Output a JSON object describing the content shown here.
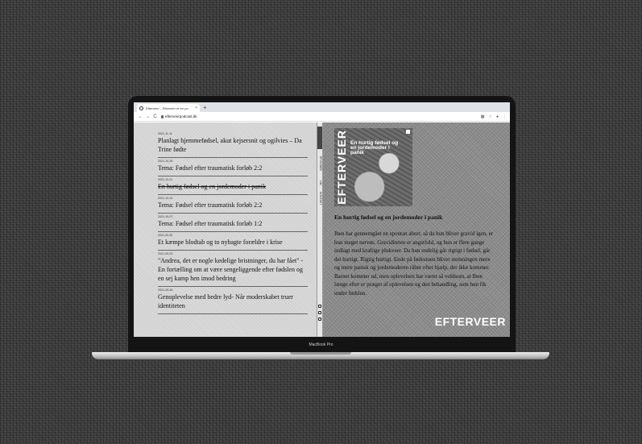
{
  "browser": {
    "tab_title": "Efterveer – Efterveer er en pu",
    "tab_close": "×",
    "new_tab": "+",
    "nav_back": "←",
    "nav_forward": "→",
    "nav_reload": "C",
    "url": "efterveerpodcast.dk",
    "toolbar_icons": [
      "extensions-icon",
      "star-icon",
      "profile-icon",
      "menu-icon"
    ]
  },
  "episodes": [
    {
      "date": "2021-11-11",
      "title": "Planlagt hjemmefødsel, akut kejsersnit og ogilvies – Da Trine fødte",
      "struck": false
    },
    {
      "date": "2021-10-28",
      "title": "Tema: Fødsel efter traumatisk forløb 2:2",
      "struck": false
    },
    {
      "date": "2021-10-21",
      "title": "En hurtig fødsel og en jordemoder i panik",
      "struck": true
    },
    {
      "date": "2021-10-14",
      "title": "Tema: Fødsel efter traumatisk forløb 2:2",
      "struck": false
    },
    {
      "date": "2021-10-07",
      "title": "Tema: Fødsel efter traumatisk forløb 1:2",
      "struck": false
    },
    {
      "date": "2021-09-30",
      "title": "Et kæmpe blodtab og to nybagte forældre i krise",
      "struck": false
    },
    {
      "date": "2021-09-23",
      "title": "\"Andrea, det er nogle kedelige bristninger, du har fået\" - En fortælling om at være sengeliggende efter fødslen og en sej kamp hen imod bedring",
      "struck": false
    },
    {
      "date": "2021-09-16",
      "title": "Genoplevelse med bedre lyd- Når moderskabet truer identiteten",
      "struck": false
    }
  ],
  "side_nav": {
    "labels": [
      "EPISODER",
      "OM",
      "KONTAKT"
    ],
    "social_icons": [
      "instagram-icon",
      "facebook-icon",
      "mail-icon"
    ]
  },
  "detail": {
    "cover_brand": "EFTERVEER",
    "cover_text": "En hurtig fødsel og en jordemoder i panik",
    "heading": "En hurtig fødsel og en jordemoder i panik",
    "description": "Iben har gennemgået en spontan abort, så da hun bliver gravid igen, er hun meget nervøs. Graviditeten er angstfuld, og hun er flere gange indlagt med kraftige plukveer. Da hun endelig går rigtigt i fødsel, går det hurtigt. Rigtig hurtigt. Ende på fødestuen bliver stemningen mere og mere panisk og jordemoderen råber efter hjælp, der ikke kommer. Barnet kommer ud, men oplevelsen har været så voldsom, at Iben længe efter er præget af oplevelsen og den behandling, som hun fik under fødslen.",
    "wordmark": "EFTERVEER"
  },
  "device": {
    "model": "MacBook Pro"
  }
}
